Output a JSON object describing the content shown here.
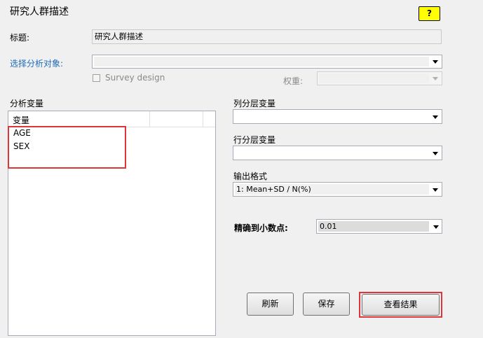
{
  "window_title": "研究人群描述",
  "help_label": "?",
  "title_field": {
    "label": "标题:",
    "value": "研究人群描述"
  },
  "analysis_object": {
    "label": "选择分析对象:",
    "value": ""
  },
  "survey_design": {
    "label": "Survey design",
    "checked": false
  },
  "weight": {
    "label": "权重:",
    "value": ""
  },
  "analysis_vars": {
    "label": "分析变量",
    "column_header": "变量",
    "items": [
      "AGE",
      "SEX"
    ]
  },
  "col_strata": {
    "label": "列分层变量",
    "value": ""
  },
  "row_strata": {
    "label": "行分层变量",
    "value": ""
  },
  "output_format": {
    "label": "输出格式",
    "value": "1: Mean+SD / N(%)"
  },
  "precision": {
    "label": "精确到小数点:",
    "value": "0.01"
  },
  "buttons": {
    "refresh": "刷新",
    "save": "保存",
    "view_results": "查看结果"
  },
  "colors": {
    "highlight": "#e0343b",
    "help_bg": "#ffff00",
    "link_label": "#1e6bb8"
  }
}
